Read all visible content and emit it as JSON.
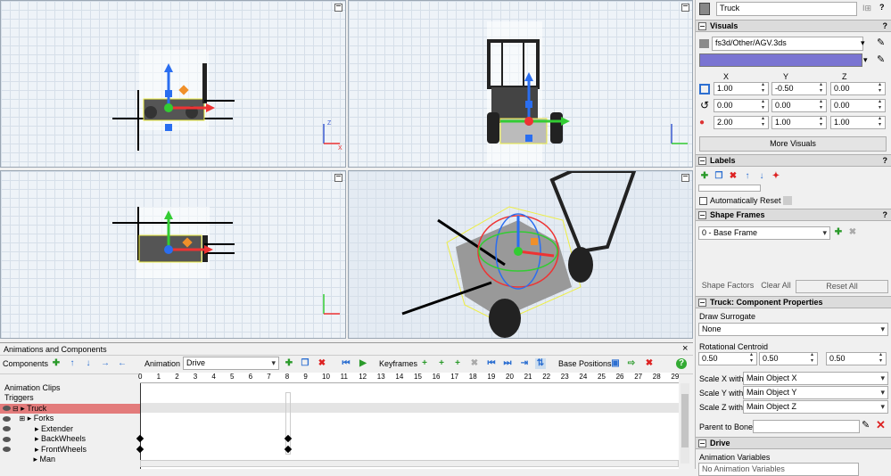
{
  "object_name": "Truck",
  "visuals": {
    "title": "Visuals",
    "shape_file": "fs3d/Other/AGV.3ds",
    "color": "#7a74d2",
    "axes": [
      "X",
      "Y",
      "Z"
    ],
    "position": [
      "1.00",
      "-0.50",
      "0.00"
    ],
    "rotation": [
      "0.00",
      "0.00",
      "0.00"
    ],
    "size": [
      "2.00",
      "1.00",
      "1.00"
    ],
    "more_visuals": "More Visuals"
  },
  "labels": {
    "title": "Labels",
    "auto_reset": "Automatically Reset"
  },
  "shape_frames": {
    "title": "Shape Frames",
    "selected": "0 - Base Frame",
    "shape_factors": "Shape Factors",
    "clear_all": "Clear All",
    "reset_all": "Reset All"
  },
  "component": {
    "title": "Truck: Component Properties",
    "draw_surrogate_label": "Draw Surrogate",
    "draw_surrogate": "None",
    "rot_centroid_label": "Rotational Centroid",
    "centroid": [
      "0.50",
      "0.50",
      "0.50"
    ],
    "scale_x_label": "Scale X with",
    "scale_x": "Main Object X",
    "scale_y_label": "Scale Y with",
    "scale_y": "Main Object Y",
    "scale_z_label": "Scale Z with",
    "scale_z": "Main Object Z",
    "parent_label": "Parent to Bone"
  },
  "drive": {
    "title": "Drive",
    "anim_vars": "Animation Variables",
    "no_vars": "No Animation Variables"
  },
  "anim": {
    "title": "Animations and Components",
    "close": "×",
    "components_label": "Components",
    "animation_label": "Animation",
    "animation": "Drive",
    "keyframes_label": "Keyframes",
    "base_positions_label": "Base Positions",
    "clips": "Animation Clips",
    "triggers": "Triggers",
    "tree": [
      "Truck",
      "Forks",
      "Extender",
      "BackWheels",
      "FrontWheels",
      "Man"
    ],
    "ticks": [
      "0",
      "1",
      "2",
      "3",
      "4",
      "5",
      "6",
      "7",
      "8",
      "9",
      "10",
      "11",
      "12",
      "13",
      "14",
      "15",
      "16",
      "17",
      "18",
      "19",
      "20",
      "21",
      "22",
      "23",
      "24",
      "25",
      "26",
      "27",
      "28",
      "29"
    ]
  },
  "axis_labels": {
    "z": "Z",
    "x": "X"
  }
}
